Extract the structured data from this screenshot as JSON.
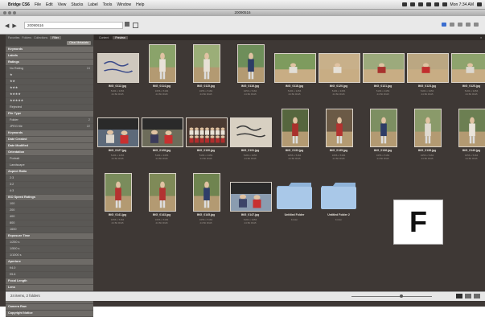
{
  "menubar": {
    "app": "Bridge CS6",
    "items": [
      "File",
      "Edit",
      "View",
      "Stacks",
      "Label",
      "Tools",
      "Window",
      "Help"
    ],
    "clock": "Mon 7:34 AM"
  },
  "window": {
    "title": "20090516"
  },
  "pathbar": {
    "back": "◀",
    "fwd": "▶",
    "path": "20090516"
  },
  "leftpanel": {
    "tabs": [
      "Favorites",
      "Folders",
      "Collections",
      "Filter"
    ],
    "active_tab": "Filter",
    "button_row": {
      "label": "",
      "button": "Clear Metadata"
    },
    "rows": [
      {
        "label": "Keywords",
        "count": "",
        "head": true
      },
      {
        "label": "Labels",
        "count": "",
        "head": true
      },
      {
        "label": "Ratings",
        "count": "",
        "head": true
      },
      {
        "label": "No Rating",
        "count": "24"
      },
      {
        "label": "★",
        "count": ""
      },
      {
        "label": "★★",
        "count": ""
      },
      {
        "label": "★★★",
        "count": ""
      },
      {
        "label": "★★★★",
        "count": ""
      },
      {
        "label": "★★★★★",
        "count": ""
      },
      {
        "label": "Rejected",
        "count": ""
      },
      {
        "label": "File Type",
        "count": "",
        "head": true
      },
      {
        "label": "Folder",
        "count": "2"
      },
      {
        "label": "JPEG file",
        "count": "22"
      },
      {
        "label": "Keywords",
        "count": "",
        "head": true
      },
      {
        "label": "Date Created",
        "count": "",
        "head": true
      },
      {
        "label": "Date Modified",
        "count": "",
        "head": true
      },
      {
        "label": "Orientation",
        "count": "",
        "head": true
      },
      {
        "label": "Portrait",
        "count": ""
      },
      {
        "label": "Landscape",
        "count": ""
      },
      {
        "label": "Aspect Ratio",
        "count": "",
        "head": true
      },
      {
        "label": "2:3",
        "count": ""
      },
      {
        "label": "3:2",
        "count": ""
      },
      {
        "label": "4:3",
        "count": ""
      },
      {
        "label": "ISO Speed Ratings",
        "count": "",
        "head": true
      },
      {
        "label": "100",
        "count": ""
      },
      {
        "label": "200",
        "count": ""
      },
      {
        "label": "400",
        "count": ""
      },
      {
        "label": "800",
        "count": ""
      },
      {
        "label": "1600",
        "count": ""
      },
      {
        "label": "Exposure Time",
        "count": "",
        "head": true
      },
      {
        "label": "1/250 s",
        "count": ""
      },
      {
        "label": "1/500 s",
        "count": ""
      },
      {
        "label": "1/1000 s",
        "count": ""
      },
      {
        "label": "Aperture",
        "count": "",
        "head": true
      },
      {
        "label": "f/4.0",
        "count": ""
      },
      {
        "label": "f/5.6",
        "count": ""
      },
      {
        "label": "Focal Length",
        "count": "",
        "head": true
      },
      {
        "label": "Lens",
        "count": "",
        "head": true
      },
      {
        "label": "Model",
        "count": "",
        "head": true
      },
      {
        "label": "White Balance",
        "count": "",
        "head": true
      },
      {
        "label": "Camera Raw",
        "count": "",
        "head": true
      },
      {
        "label": "Copyright Notice",
        "count": "",
        "head": true
      }
    ]
  },
  "content": {
    "tabs": [
      "Content",
      "Preview"
    ],
    "active_tab": "Preview"
  },
  "thumbnails": [
    {
      "name": "IMG_0112.jpg",
      "meta": "5184 x 3456\n24 Bit RGB",
      "kind": "sign",
      "bg": "#cfc8be",
      "fg": "#3a4a8a"
    },
    {
      "name": "IMG_0114.jpg",
      "meta": "3456 x 5184\n24 Bit RGB",
      "kind": "player",
      "bg": "#8aa36a",
      "fg": "#e8e2d8"
    },
    {
      "name": "IMG_0115.jpg",
      "meta": "3456 x 5184\n24 Bit RGB",
      "kind": "player",
      "bg": "#9bae78",
      "fg": "#e7e0d5"
    },
    {
      "name": "IMG_0116.jpg",
      "meta": "3456 x 5184\n24 Bit RGB",
      "kind": "player",
      "bg": "#6e8e5a",
      "fg": "#2d3d66"
    },
    {
      "name": "IMG_0118.jpg",
      "meta": "5184 x 3456\n24 Bit RGB",
      "kind": "field",
      "bg": "#7e9b5e",
      "fg": "#e2ded6"
    },
    {
      "name": "IMG_0120.jpg",
      "meta": "5184 x 3456\n24 Bit RGB",
      "kind": "field",
      "bg": "#c8b08a",
      "fg": "#e6e0d6"
    },
    {
      "name": "IMG_0121.jpg",
      "meta": "5184 x 3456\n24 Bit RGB",
      "kind": "field",
      "bg": "#9caa7c",
      "fg": "#a8322e"
    },
    {
      "name": "IMG_0123.jpg",
      "meta": "5184 x 3456\n24 Bit RGB",
      "kind": "field",
      "bg": "#bba782",
      "fg": "#c22e2e"
    },
    {
      "name": "IMG_0125.jpg",
      "meta": "5184 x 3456\n24 Bit RGB",
      "kind": "field",
      "bg": "#8ea36d",
      "fg": "#ddd8cf"
    },
    {
      "name": "IMG_0127.jpg",
      "meta": "5184 x 3456\n24 Bit RGB",
      "kind": "dugout",
      "bg": "#5d6a7a",
      "fg": "#dcd6cc"
    },
    {
      "name": "IMG_0128.jpg",
      "meta": "5184 x 3456\n24 Bit RGB",
      "kind": "dugout",
      "bg": "#6d6c5a",
      "fg": "#3a3a5a"
    },
    {
      "name": "IMG_0130.jpg",
      "meta": "5184 x 3456\n24 Bit RGB",
      "kind": "team",
      "bg": "#4a3a32",
      "fg": "#e8e2d6"
    },
    {
      "name": "IMG_0131.jpg",
      "meta": "5184 x 3456\n24 Bit RGB",
      "kind": "sign",
      "bg": "#d8d0c2",
      "fg": "#3a3a3a"
    },
    {
      "name": "IMG_0133.jpg",
      "meta": "3456 x 5184\n24 Bit RGB",
      "kind": "player",
      "bg": "#56663e",
      "fg": "#a9302c"
    },
    {
      "name": "IMG_0135.jpg",
      "meta": "3456 x 5184\n24 Bit RGB",
      "kind": "player",
      "bg": "#6b5a46",
      "fg": "#b23330"
    },
    {
      "name": "IMG_0136.jpg",
      "meta": "3456 x 5184\n24 Bit RGB",
      "kind": "player",
      "bg": "#7d8f62",
      "fg": "#2e3c66"
    },
    {
      "name": "IMG_0138.jpg",
      "meta": "3456 x 5184\n24 Bit RGB",
      "kind": "player",
      "bg": "#8a9a6a",
      "fg": "#e0dad0"
    },
    {
      "name": "IMG_0140.jpg",
      "meta": "3456 x 5184\n24 Bit RGB",
      "kind": "player",
      "bg": "#6c7f52",
      "fg": "#eae4da"
    },
    {
      "name": "IMG_0141.jpg",
      "meta": "3456 x 5184\n24 Bit RGB",
      "kind": "player",
      "bg": "#7a8c5c",
      "fg": "#b53230"
    },
    {
      "name": "IMG_0143.jpg",
      "meta": "3456 x 5184\n24 Bit RGB",
      "kind": "player",
      "bg": "#7f8a58",
      "fg": "#b33331"
    },
    {
      "name": "IMG_0145.jpg",
      "meta": "3456 x 5184\n24 Bit RGB",
      "kind": "player",
      "bg": "#6f8450",
      "fg": "#2f3e6a"
    },
    {
      "name": "IMG_0147.jpg",
      "meta": "5184 x 3456\n24 Bit RGB",
      "kind": "dugout",
      "bg": "#8a9cb0",
      "fg": "#3c4468"
    }
  ],
  "folders": [
    {
      "name": "Untitled Folder",
      "meta": "Folder"
    },
    {
      "name": "Untitled Folder 2",
      "meta": "Folder"
    }
  ],
  "statusbar": {
    "text": "24 items, 2 folders"
  },
  "overlay_letter": "F"
}
